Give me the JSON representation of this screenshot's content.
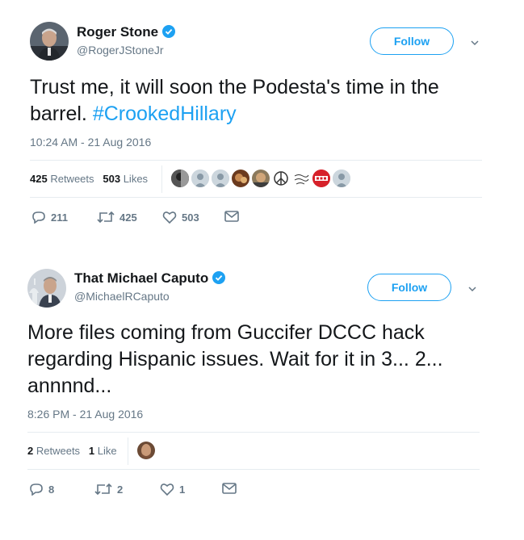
{
  "tweets": [
    {
      "name": "Roger Stone",
      "handle": "@RogerJStoneJr",
      "follow_label": "Follow",
      "text": "Trust me, it will soon the Podesta's time in the barrel. ",
      "hashtag": "#CrookedHillary",
      "timestamp": "10:24 AM - 21 Aug 2016",
      "retweets_count": "425",
      "retweets_label": "Retweets",
      "likes_count": "503",
      "likes_label": "Likes",
      "liker_avatars": [
        "photo",
        "default",
        "default",
        "photo",
        "photo",
        "peace",
        "script",
        "vfn",
        "default"
      ],
      "actions": {
        "replies": "211",
        "retweets": "425",
        "likes": "503"
      }
    },
    {
      "name": "That Michael Caputo",
      "handle": "@MichaelRCaputo",
      "follow_label": "Follow",
      "text": "More files coming from Guccifer DCCC hack regarding Hispanic issues. Wait for it in 3... 2... annnnd...",
      "timestamp": "8:26 PM - 21 Aug 2016",
      "retweets_count": "2",
      "retweets_label": "Retweets",
      "likes_count": "1",
      "likes_label": "Like",
      "liker_avatars": [
        "photo"
      ],
      "actions": {
        "replies": "8",
        "retweets": "2",
        "likes": "1"
      }
    }
  ],
  "colors": {
    "accent": "#1da1f2",
    "text": "#14171a",
    "muted": "#657786",
    "divider": "#e6ecf0",
    "vfn_red": "#d6212a"
  },
  "icons": [
    "verified-badge-icon",
    "chevron-down-icon",
    "reply-icon",
    "retweet-icon",
    "like-icon",
    "message-icon"
  ]
}
